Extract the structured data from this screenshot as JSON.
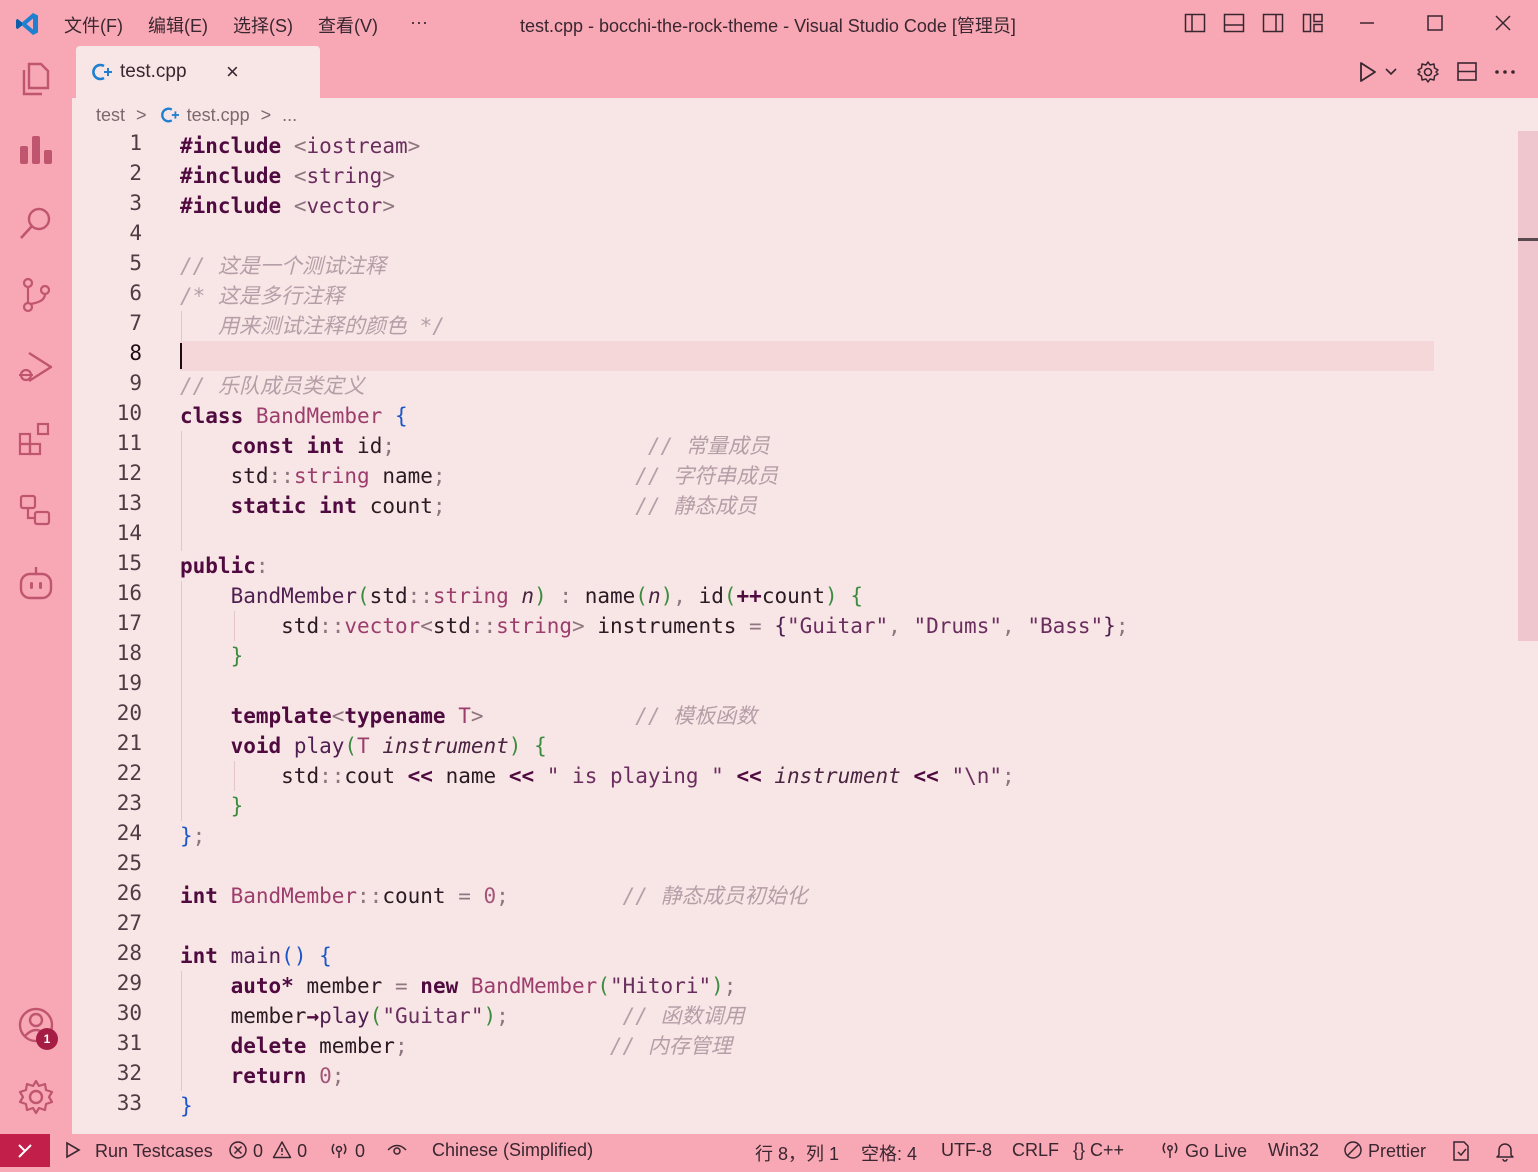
{
  "titlebar": {
    "menus": [
      "文件(F)",
      "编辑(E)",
      "选择(S)",
      "查看(V)",
      "···"
    ],
    "title": "test.cpp - bocchi-the-rock-theme - Visual Studio Code [管理员]",
    "icons": [
      "toggle-primary-sidebar-icon",
      "toggle-panel-icon",
      "toggle-secondary-sidebar-icon",
      "customize-layout-icon",
      "minimize-icon",
      "maximize-icon",
      "close-icon"
    ]
  },
  "activity_bar": {
    "items": [
      "explorer-icon",
      "charts-icon",
      "search-icon",
      "source-control-icon",
      "run-debug-icon",
      "extensions-icon",
      "remote-explorer-icon",
      "copilot-icon"
    ],
    "bottom": [
      "accounts-icon",
      "manage-gear-icon"
    ],
    "accounts_badge": "1"
  },
  "tab": {
    "label": "test.cpp",
    "close": "×"
  },
  "editor_actions": [
    "run-icon",
    "run-dropdown-icon",
    "settings-icon",
    "split-editor-icon",
    "more-actions-icon"
  ],
  "breadcrumb": {
    "folder": "test",
    "sep1": ">",
    "file": "test.cpp",
    "sep2": ">",
    "more": "..."
  },
  "code": {
    "line_numbers": [
      "1",
      "2",
      "3",
      "4",
      "5",
      "6",
      "7",
      "8",
      "9",
      "10",
      "11",
      "12",
      "13",
      "14",
      "15",
      "16",
      "17",
      "18",
      "19",
      "20",
      "21",
      "22",
      "23",
      "24",
      "25",
      "26",
      "27",
      "28",
      "29",
      "30",
      "31",
      "32",
      "33"
    ],
    "cursor_line": "8",
    "t": {
      "include": "#include",
      "lt": "<",
      "gt": ">",
      "iostream": "iostream",
      "string": "string",
      "vector": "vector",
      "c5": "// 这是一个测试注释",
      "c6": "/* 这是多行注释",
      "c7": "用来测试注释的颜色 */",
      "c9": "// 乐队成员类定义",
      "class": "class",
      "BandMember": "BandMember",
      "lbrace": "{",
      "rbrace": "}",
      "const": "const",
      "int": "int",
      "id": "id",
      "semi": ";",
      "c11": "// 常量成员",
      "std": "std",
      "scope": "::",
      "name": "name",
      "c12": "// 字符串成员",
      "static": "static",
      "count": "count",
      "c13": "// 静态成员",
      "public": "public",
      "colon": ":",
      "lparen": "(",
      "rparen": ")",
      "n": "n",
      "comma": ",",
      "inc": "++",
      "instruments": "instruments",
      "eq": "=",
      "guitar": "\"Guitar\"",
      "drums": "\"Drums\"",
      "bass": "\"Bass\"",
      "template": "template",
      "typename": "typename",
      "T": "T",
      "c20": "// 模板函数",
      "void": "void",
      "play": "play",
      "instrument": "instrument",
      "cout": "cout",
      "shl": "<<",
      "playing": "\" is playing \"",
      "nl": "\"\\n\"",
      "zero": "0",
      "c26": "// 静态成员初始化",
      "main": "main",
      "auto": "auto",
      "star": "*",
      "member": "member",
      "new": "new",
      "hitori": "\"Hitori\"",
      "arrow": "→",
      "c30": "// 函数调用",
      "delete": "delete",
      "c31": "// 内存管理",
      "return": "return"
    }
  },
  "statusbar": {
    "remote_icon": "remote-icon",
    "run_testcases": "Run Testcases",
    "errors": "0",
    "warnings": "0",
    "ports": "0",
    "language_pack": "Chinese (Simplified)",
    "position": "行 8，列 1",
    "spaces": "空格: 4",
    "encoding": "UTF-8",
    "eol": "CRLF",
    "language": "{} C++",
    "go_live": "Go Live",
    "platform": "Win32",
    "prettier": "Prettier"
  }
}
